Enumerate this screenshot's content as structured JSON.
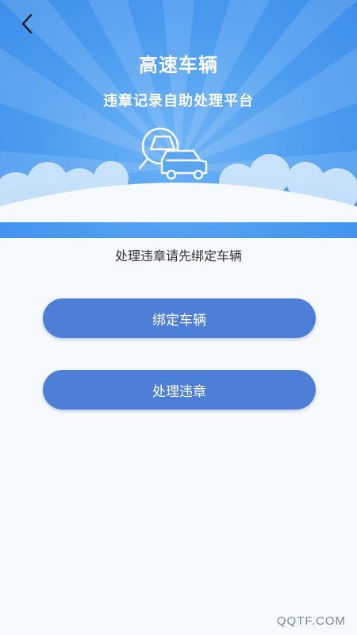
{
  "header": {
    "title": "高速车辆",
    "subtitle": "违章记录自助处理平台",
    "back_icon": "chevron-left-icon",
    "illustration_icon": "car-search-icon"
  },
  "main": {
    "hint": "处理违章请先绑定车辆",
    "bind_label": "绑定车辆",
    "handle_label": "处理违章"
  },
  "watermark": "QQTF.COM",
  "colors": {
    "header_blue": "#4b9cf0",
    "button_blue": "#4e7fd8",
    "background": "#f6f9fd"
  }
}
